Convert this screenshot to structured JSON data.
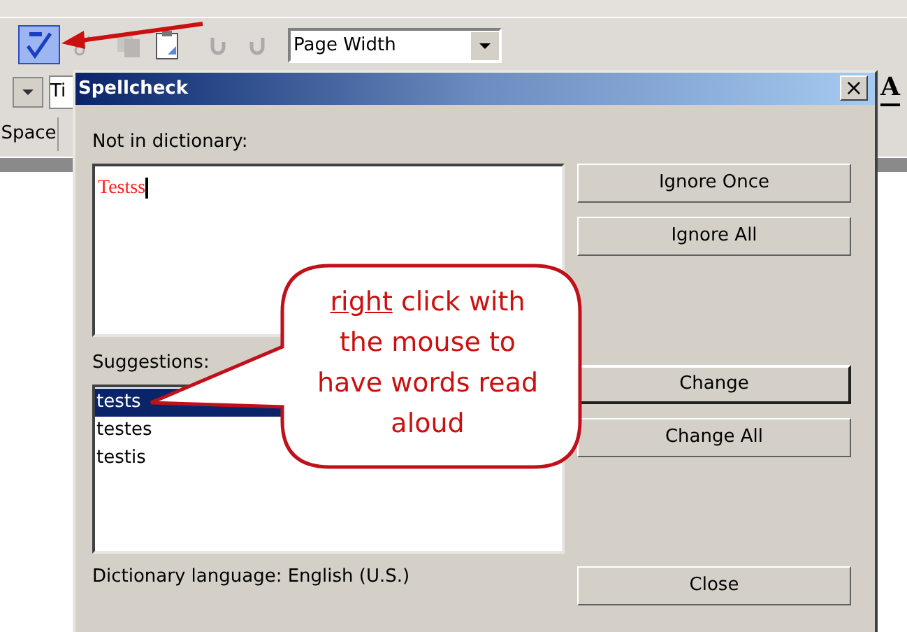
{
  "toolbar": {
    "spellcheck_active": true,
    "zoom_select": {
      "value": "Page Width"
    }
  },
  "format_bar": {
    "field_value": "Ti",
    "bold_letter": "A"
  },
  "side_button": "Space",
  "dialog": {
    "title": "Spellcheck",
    "close_glyph": "×",
    "not_in_dictionary_label": "Not in dictionary:",
    "misspelled_word": "Testss",
    "suggestions_label": "Suggestions:",
    "suggestions": [
      {
        "text": "tests",
        "selected": true
      },
      {
        "text": "testes",
        "selected": false
      },
      {
        "text": "testis",
        "selected": false
      }
    ],
    "button_groups": [
      [
        {
          "label": "Ignore Once",
          "default": false
        },
        {
          "label": "Ignore All",
          "default": false
        }
      ],
      [
        {
          "label": "Change",
          "default": true
        },
        {
          "label": "Change All",
          "default": false
        }
      ],
      [
        {
          "label": "Close",
          "default": false
        }
      ]
    ],
    "language": "Dictionary language: English (U.S.)"
  },
  "callout": {
    "underlined": "right",
    "rest": " click with the mouse to have words read aloud"
  }
}
